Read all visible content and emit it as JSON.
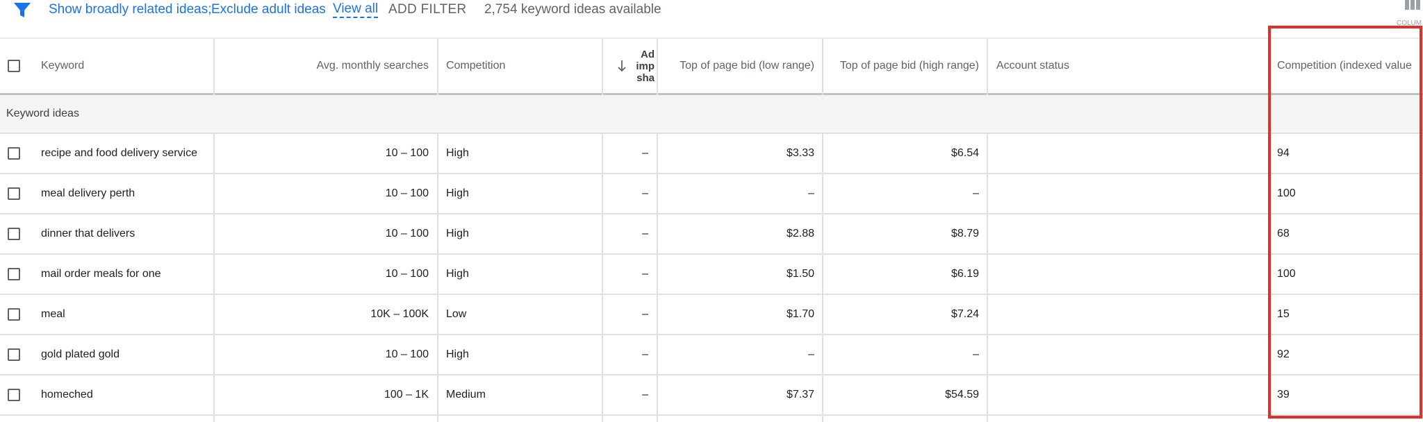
{
  "toolbar": {
    "show_broadly": "Show broadly related ideas;",
    "exclude_adult": "Exclude adult ideas",
    "view_all": "View all",
    "add_filter": "ADD FILTER",
    "count": "2,754 keyword ideas available",
    "columns_label": "COLUM"
  },
  "columns": {
    "keyword": "Keyword",
    "avg_searches": "Avg. monthly searches",
    "competition": "Competition",
    "ad_share_1": "Ad",
    "ad_share_2": "imp",
    "ad_share_3": "sha",
    "bid_low": "Top of page bid (low range)",
    "bid_high": "Top of page bid (high range)",
    "account_status": "Account status",
    "competition_indexed": "Competition (indexed value"
  },
  "group": {
    "label": "Keyword ideas"
  },
  "rows": [
    {
      "keyword": "recipe and food delivery service",
      "searches": "10 – 100",
      "competition": "High",
      "ad_share": "–",
      "bid_low": "$3.33",
      "bid_high": "$6.54",
      "status": "",
      "indexed": "94"
    },
    {
      "keyword": "meal delivery perth",
      "searches": "10 – 100",
      "competition": "High",
      "ad_share": "–",
      "bid_low": "–",
      "bid_high": "–",
      "status": "",
      "indexed": "100"
    },
    {
      "keyword": "dinner that delivers",
      "searches": "10 – 100",
      "competition": "High",
      "ad_share": "–",
      "bid_low": "$2.88",
      "bid_high": "$8.79",
      "status": "",
      "indexed": "68"
    },
    {
      "keyword": "mail order meals for one",
      "searches": "10 – 100",
      "competition": "High",
      "ad_share": "–",
      "bid_low": "$1.50",
      "bid_high": "$6.19",
      "status": "",
      "indexed": "100"
    },
    {
      "keyword": "meal",
      "searches": "10K – 100K",
      "competition": "Low",
      "ad_share": "–",
      "bid_low": "$1.70",
      "bid_high": "$7.24",
      "status": "",
      "indexed": "15"
    },
    {
      "keyword": "gold plated gold",
      "searches": "10 – 100",
      "competition": "High",
      "ad_share": "–",
      "bid_low": "–",
      "bid_high": "–",
      "status": "",
      "indexed": "92"
    },
    {
      "keyword": "homeched",
      "searches": "100 – 1K",
      "competition": "Medium",
      "ad_share": "–",
      "bid_low": "$7.37",
      "bid_high": "$54.59",
      "status": "",
      "indexed": "39"
    }
  ],
  "colors": {
    "link": "#1a73e8",
    "highlight": "#e0302c",
    "text": "#202124",
    "muted": "#5f6368"
  },
  "icons": {
    "filter": "filter-icon",
    "sort": "arrow-down-icon",
    "columns": "columns-icon"
  }
}
